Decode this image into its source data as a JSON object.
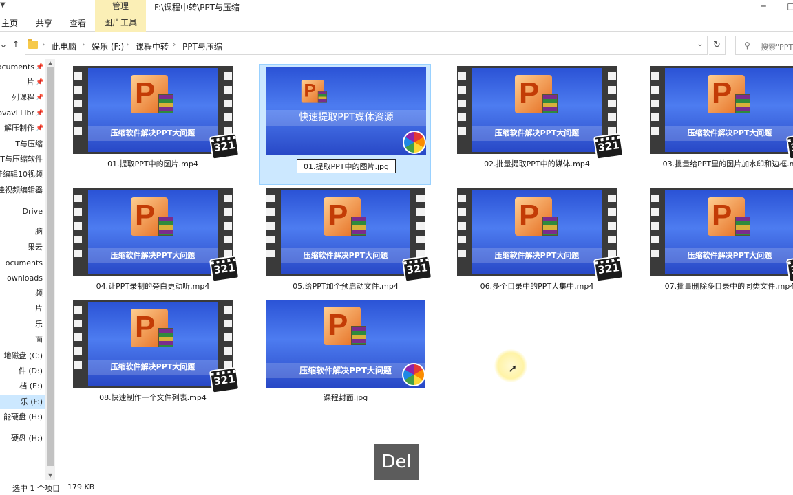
{
  "title_bar": {
    "manage_tab": "管理",
    "path": "F:\\课程中转\\PPT与压缩",
    "minimize": "─",
    "maximize": "□"
  },
  "ribbon": {
    "tabs": [
      "主页",
      "共享",
      "查看",
      "图片工具"
    ]
  },
  "address_bar": {
    "crumbs": [
      "此电脑",
      "娱乐 (F:)",
      "课程中转",
      "PPT与压缩"
    ],
    "search_placeholder": "搜索\"PPT"
  },
  "sidebar": {
    "items": [
      {
        "label": "ocuments",
        "pinned": true
      },
      {
        "label": "片",
        "pinned": true
      },
      {
        "label": "列课程",
        "pinned": true
      },
      {
        "label": "ovavi Libr",
        "pinned": true
      },
      {
        "label": "解压制作",
        "pinned": true
      },
      {
        "label": "T与压缩",
        "pinned": false
      },
      {
        "label": "T与压缩软件",
        "pinned": false
      },
      {
        "label": "佳编辑10视频",
        "pinned": false
      },
      {
        "label": "佳视频编辑器",
        "pinned": false
      },
      {
        "label": "Drive",
        "pinned": false
      },
      {
        "label": "脑",
        "pinned": false
      },
      {
        "label": "果云",
        "pinned": false
      },
      {
        "label": "ocuments",
        "pinned": false
      },
      {
        "label": "ownloads",
        "pinned": false
      },
      {
        "label": "频",
        "pinned": false
      },
      {
        "label": "片",
        "pinned": false
      },
      {
        "label": "乐",
        "pinned": false
      },
      {
        "label": "面",
        "pinned": false
      },
      {
        "label": "地磁盘 (C:)",
        "pinned": false
      },
      {
        "label": "件 (D:)",
        "pinned": false
      },
      {
        "label": "档 (E:)",
        "pinned": false
      },
      {
        "label": "乐 (F:)",
        "pinned": false,
        "selected": true
      },
      {
        "label": "能硬盘 (H:)",
        "pinned": false
      },
      {
        "label": "硬盘 (H:)",
        "pinned": false
      }
    ]
  },
  "files": [
    {
      "name": "01.提取PPT中的图片.mp4",
      "kind": "video",
      "thumb_text": "压缩软件解决PPT大问题"
    },
    {
      "name": "01.提取PPT中的图片.jpg",
      "kind": "image",
      "thumb_text": "快速提取PPT媒体资源",
      "selected": true
    },
    {
      "name": "02.批量提取PPT中的媒体.mp4",
      "kind": "video",
      "thumb_text": "压缩软件解决PPT大问题"
    },
    {
      "name": "03.批量给PPT里的图片加水印和边框.m",
      "kind": "video",
      "thumb_text": "压缩软件解决PPT大问题"
    },
    {
      "name": "04.让PPT录制的旁白更动听.mp4",
      "kind": "video",
      "thumb_text": "压缩软件解决PPT大问题"
    },
    {
      "name": "05.给PPT加个预启动文件.mp4",
      "kind": "video",
      "thumb_text": "压缩软件解决PPT大问题"
    },
    {
      "name": "06.多个目录中的PPT大集中.mp4",
      "kind": "video",
      "thumb_text": "压缩软件解决PPT大问题"
    },
    {
      "name": "07.批量删除多目录中的同类文件.mp4",
      "kind": "video",
      "thumb_text": "压缩软件解决PPT大问题"
    },
    {
      "name": "08.快速制作一个文件列表.mp4",
      "kind": "video",
      "thumb_text": "压缩软件解决PPT大问题"
    },
    {
      "name": "课程封面.jpg",
      "kind": "image",
      "thumb_text": "压缩软件解决PPT大问题"
    }
  ],
  "badge_text": "321",
  "keycast": "Del",
  "status": {
    "selection": "选中 1 个项目",
    "size": "179 KB"
  }
}
